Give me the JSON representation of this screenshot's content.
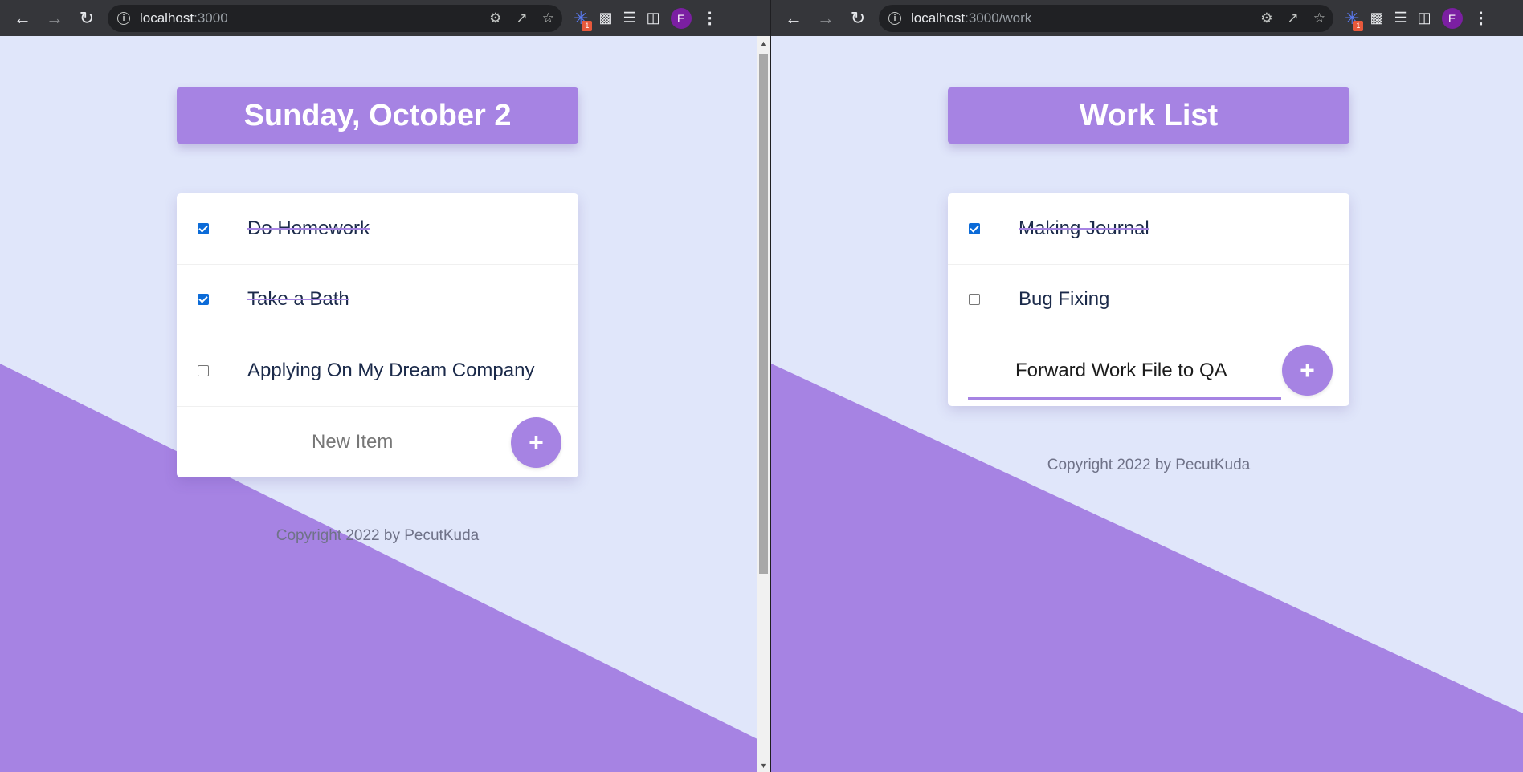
{
  "colors": {
    "accent": "#a683e3",
    "page_bg": "#e0e6fa",
    "text": "#1b2a4a"
  },
  "left_window": {
    "url_host": "localhost",
    "url_rest": ":3000",
    "heading": "Sunday, October 2",
    "items": [
      {
        "label": "Do Homework",
        "checked": true
      },
      {
        "label": "Take a Bath",
        "checked": true
      },
      {
        "label": "Applying On My Dream Company",
        "checked": false
      }
    ],
    "new_item_placeholder": "New Item",
    "add_button": "+",
    "footer": "Copyright 2022 by PecutKuda"
  },
  "right_window": {
    "url_host": "localhost",
    "url_rest": ":3000/work",
    "heading": "Work List",
    "items": [
      {
        "label": "Making Journal",
        "checked": true
      },
      {
        "label": "Bug Fixing",
        "checked": false
      }
    ],
    "new_item_value": "Forward Work File to QA",
    "add_button": "+",
    "footer": "Copyright 2022 by PecutKuda"
  },
  "browser": {
    "extension_badge": "1",
    "profile_initial": "E"
  }
}
